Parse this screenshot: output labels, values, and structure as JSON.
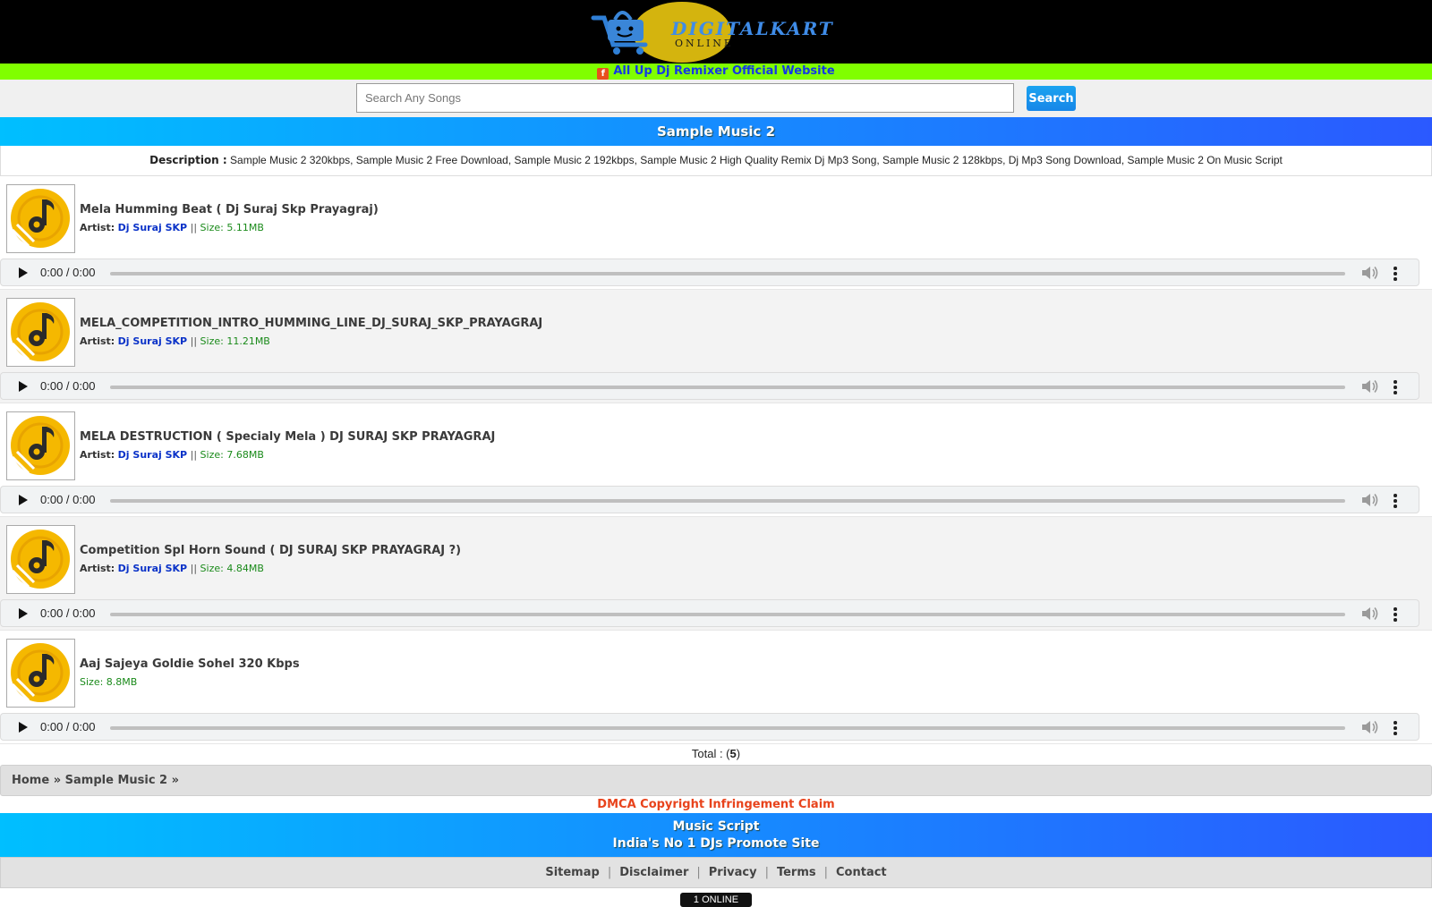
{
  "header": {
    "logo_text": "DIGITALKART",
    "logo_subtext": "ONLINE",
    "promo_link": "All Up Dj Remixer Official Website"
  },
  "search": {
    "placeholder": "Search Any Songs",
    "button_label": "Search"
  },
  "page_title": "Sample Music 2",
  "description": {
    "label": "Description :",
    "text": "Sample Music 2 320kbps, Sample Music 2 Free Download, Sample Music 2 192kbps, Sample Music 2 High Quality Remix Dj Mp3 Song, Sample Music 2 128kbps, Dj Mp3 Song Download, Sample Music 2 On Music Script"
  },
  "songs": [
    {
      "title": "Mela Humming Beat ( Dj Suraj Skp Prayagraj)",
      "artist_label": "Artist:",
      "artist": "Dj Suraj SKP",
      "separator": "||",
      "size": "Size: 5.11MB",
      "time": "0:00 / 0:00"
    },
    {
      "title": "MELA_COMPETITION_INTRO_HUMMING_LINE_DJ_SURAJ_SKP_PRAYAGRAJ",
      "artist_label": "Artist:",
      "artist": "Dj Suraj SKP",
      "separator": "||",
      "size": "Size: 11.21MB",
      "time": "0:00 / 0:00"
    },
    {
      "title": "MELA DESTRUCTION ( Specialy Mela ) DJ SURAJ SKP PRAYAGRAJ",
      "artist_label": "Artist:",
      "artist": "Dj Suraj SKP",
      "separator": "||",
      "size": "Size: 7.68MB",
      "time": "0:00 / 0:00"
    },
    {
      "title": "Competition Spl Horn Sound ( DJ SURAJ SKP PRAYAGRAJ ?)",
      "artist_label": "Artist:",
      "artist": "Dj Suraj SKP",
      "separator": "||",
      "size": "Size: 4.84MB",
      "time": "0:00 / 0:00"
    },
    {
      "title": "Aaj Sajeya Goldie Sohel 320 Kbps",
      "size": "Size: 8.8MB",
      "time": "0:00 / 0:00"
    }
  ],
  "total": {
    "label": "Total : (",
    "count": "5",
    "close": ")"
  },
  "breadcrumb": {
    "home": "Home",
    "sep": "»",
    "current": "Sample Music 2"
  },
  "dmca": "DMCA Copyright Infringement Claim",
  "footer": {
    "brand_line1": "Music Script",
    "brand_line2": "India's No 1 DJs Promote Site",
    "links": [
      "Sitemap",
      "Disclaimer",
      "Privacy",
      "Terms",
      "Contact"
    ],
    "link_separator": "|",
    "online_badge": "1 ONLINE"
  },
  "colors": {
    "accent_gradient_start": "#00bfff",
    "accent_gradient_end": "#2b59ff",
    "promo_bar": "#80ff00",
    "artist_link": "#0a32c8",
    "size_text": "#1a8a1a",
    "dmca_text": "#e8431c"
  },
  "icons": {
    "song_thumb": "music-note-disc-icon",
    "player_play": "play-icon",
    "player_volume": "volume-icon",
    "player_more": "more-vert-icon",
    "promo": "facebook-icon"
  }
}
